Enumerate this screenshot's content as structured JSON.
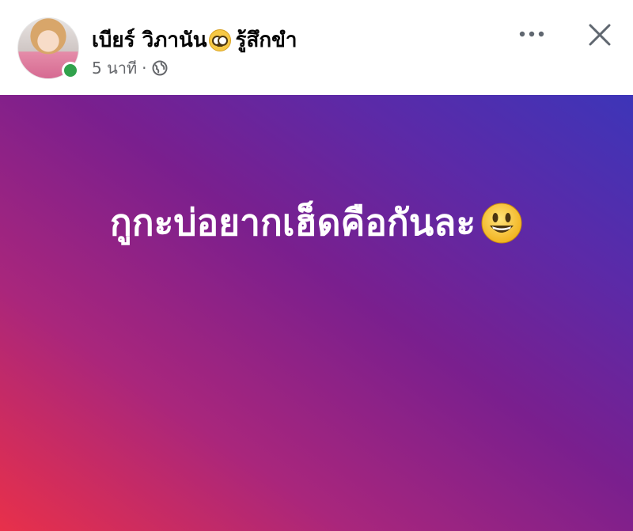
{
  "post": {
    "author_name": "เบียร์ วิภานัน",
    "feeling_emoji": "nerd-face-emoji",
    "feeling_text": "รู้สึกขำ",
    "time": "5 นาที",
    "separator": "·",
    "privacy_icon": "globe-icon",
    "body_text": "กูกะบ่อยากเฮ็ดคือกันละ",
    "body_emoji": "smiling-face-emoji",
    "online": true
  },
  "header": {
    "more_icon": "more-options-icon",
    "close_icon": "close-icon"
  },
  "colors": {
    "online_dot": "#31a24c",
    "gradient_start": "#e8304a",
    "gradient_end": "#3d35b8",
    "meta_text": "#65676b"
  }
}
